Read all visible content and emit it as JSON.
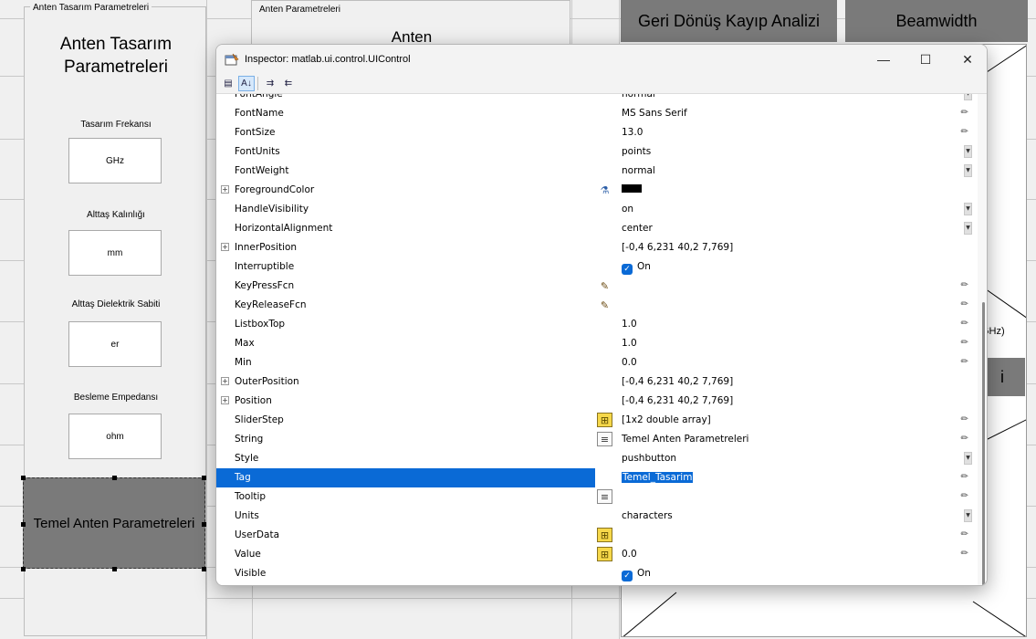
{
  "background": {
    "left_panel": {
      "legend": "Anten Tasarım Parametreleri",
      "title": "Anten Tasarım Parametreleri",
      "params": [
        {
          "label": "Tasarım Frekansı",
          "unit": "GHz"
        },
        {
          "label": "Alttaş Kalınlığı",
          "unit": "mm"
        },
        {
          "label": "Alttaş Dielektrik Sabiti",
          "unit": "er"
        },
        {
          "label": "Besleme Empedansı",
          "unit": "ohm"
        }
      ],
      "main_button": "Temel Anten Parametreleri"
    },
    "mid_panel": {
      "legend": "Anten Parametreleri",
      "title": "Anten"
    },
    "buttons": {
      "return_loss": "Geri Dönüş Kayıp Analizi",
      "beamwidth": "Beamwidth"
    },
    "fragments": {
      "ghz": "GHz)",
      "i": "i"
    }
  },
  "inspector": {
    "title": "Inspector: matlab.ui.control.UIControl",
    "controls": {
      "minimize": "—",
      "maximize": "☐",
      "close": "✕"
    },
    "toolbar": {
      "categorized": "▤",
      "alphabetical": "A↓",
      "expand": "⇉",
      "collapse": "⇇"
    },
    "selection_color": "#0a6ad6",
    "properties": [
      {
        "name": "FontAngle",
        "value": "normal",
        "control": "dropdown"
      },
      {
        "name": "FontName",
        "value": "MS Sans Serif",
        "control": "pencil"
      },
      {
        "name": "FontSize",
        "value": "13.0",
        "control": "pencil"
      },
      {
        "name": "FontUnits",
        "value": "points",
        "control": "dropdown"
      },
      {
        "name": "FontWeight",
        "value": "normal",
        "control": "dropdown"
      },
      {
        "name": "ForegroundColor",
        "value": "",
        "expand": true,
        "editor": "paint-bucket-icon",
        "swatch": "#000000"
      },
      {
        "name": "HandleVisibility",
        "value": "on",
        "control": "dropdown"
      },
      {
        "name": "HorizontalAlignment",
        "value": "center",
        "control": "dropdown"
      },
      {
        "name": "InnerPosition",
        "value": "[-0,4 6,231 40,2 7,769]",
        "expand": true
      },
      {
        "name": "Interruptible",
        "value": "On",
        "checkbox": true
      },
      {
        "name": "KeyPressFcn",
        "value": "",
        "editor": "callback-icon",
        "control": "pencil"
      },
      {
        "name": "KeyReleaseFcn",
        "value": "",
        "editor": "callback-icon",
        "control": "pencil"
      },
      {
        "name": "ListboxTop",
        "value": "1.0",
        "control": "pencil"
      },
      {
        "name": "Max",
        "value": "1.0",
        "control": "pencil"
      },
      {
        "name": "Min",
        "value": "0.0",
        "control": "pencil"
      },
      {
        "name": "OuterPosition",
        "value": "[-0,4 6,231 40,2 7,769]",
        "expand": true
      },
      {
        "name": "Position",
        "value": "[-0,4 6,231 40,2 7,769]",
        "expand": true
      },
      {
        "name": "SliderStep",
        "value": "[1x2  double array]",
        "editor": "array-icon",
        "control": "pencil"
      },
      {
        "name": "String",
        "value": "Temel Anten Parametreleri",
        "editor": "text-editor-icon",
        "control": "pencil"
      },
      {
        "name": "Style",
        "value": "pushbutton",
        "control": "dropdown"
      },
      {
        "name": "Tag",
        "value": "Temel_Tasarim",
        "selected": true,
        "control": "pencil"
      },
      {
        "name": "Tooltip",
        "value": "",
        "editor": "text-editor-icon",
        "control": "pencil"
      },
      {
        "name": "Units",
        "value": "characters",
        "control": "dropdown"
      },
      {
        "name": "UserData",
        "value": "",
        "editor": "array-icon",
        "control": "pencil"
      },
      {
        "name": "Value",
        "value": "0.0",
        "editor": "array-icon",
        "control": "pencil"
      },
      {
        "name": "Visible",
        "value": "On",
        "checkbox": true
      }
    ]
  }
}
